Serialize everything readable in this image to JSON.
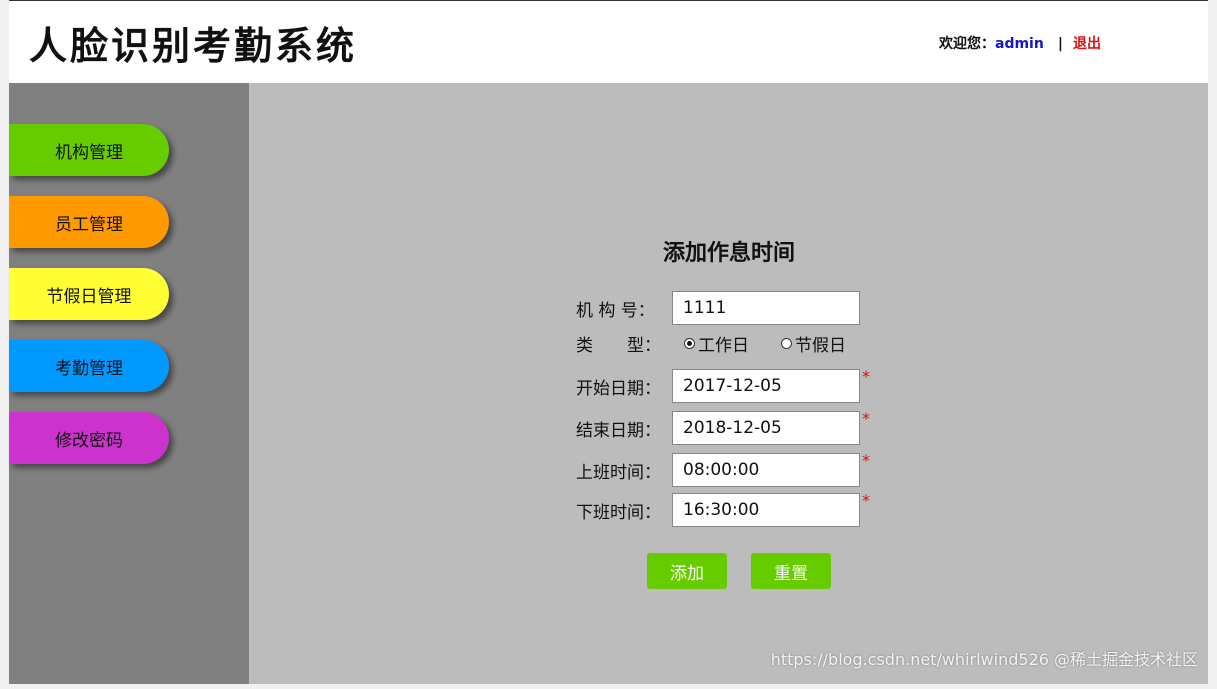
{
  "header": {
    "app_title": "人脸识别考勤系统",
    "welcome_label": "欢迎您：",
    "username": "admin",
    "separator": "|",
    "logout_label": "退出"
  },
  "sidebar": {
    "items": [
      {
        "label": "机构管理",
        "color": "#66cc00"
      },
      {
        "label": "员工管理",
        "color": "#ff9900"
      },
      {
        "label": "节假日管理",
        "color": "#ffff33"
      },
      {
        "label": "考勤管理",
        "color": "#0099ff"
      },
      {
        "label": "修改密码",
        "color": "#cc33cc"
      }
    ]
  },
  "form": {
    "title": "添加作息时间",
    "org_label": "机 构 号：",
    "org_value": "1111",
    "type_label": "类　　型：",
    "type_options": [
      "工作日",
      "节假日"
    ],
    "type_selected": "工作日",
    "start_label": "开始日期：",
    "start_value": "2017-12-05",
    "end_label": "结束日期：",
    "end_value": "2018-12-05",
    "on_label": "上班时间：",
    "on_value": "08:00:00",
    "off_label": "下班时间：",
    "off_value": "16:30:00",
    "required_mark": "*",
    "add_label": "添加",
    "reset_label": "重置"
  },
  "watermark": "https://blog.csdn.net/whirlwind526 @稀土掘金技术社区",
  "colors": {
    "accent": "#66cc00",
    "sidebar_bg": "#808080",
    "content_bg": "#bcbcbc",
    "username": "#1515c8",
    "logout": "#e01010"
  }
}
